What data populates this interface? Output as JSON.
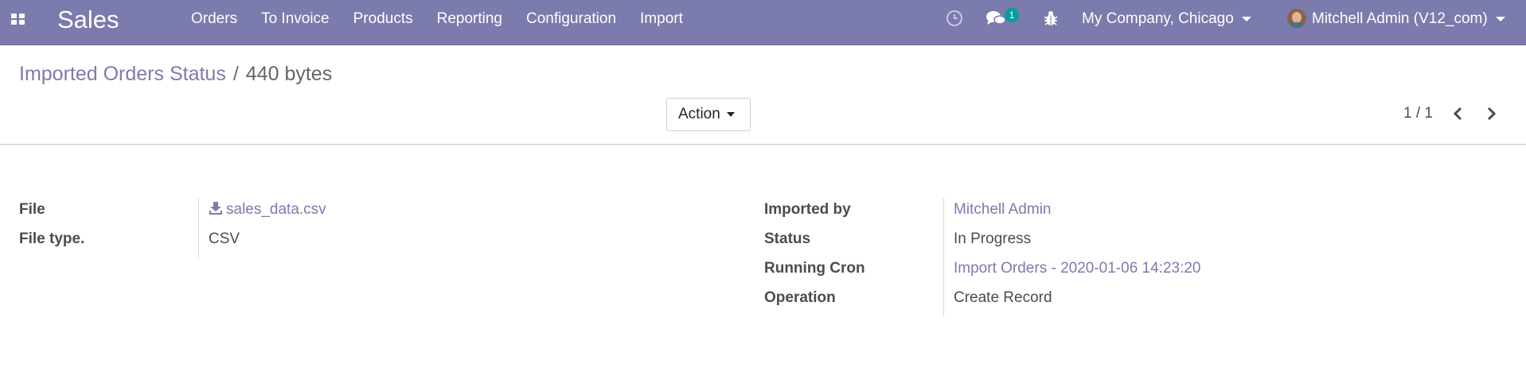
{
  "navbar": {
    "app_name": "Sales",
    "menu": [
      "Orders",
      "To Invoice",
      "Products",
      "Reporting",
      "Configuration",
      "Import"
    ],
    "messages_badge": "1",
    "company": "My Company, Chicago",
    "user": "Mitchell Admin (V12_com)",
    "icons": [
      "apps-grid-icon",
      "clock-icon",
      "chat-icon",
      "bug-icon"
    ],
    "bg_color": "#7c7bad",
    "badge_color": "#00a09d"
  },
  "breadcrumb": {
    "parent": "Imported Orders Status",
    "separator": "/",
    "current": "440 bytes"
  },
  "control_panel": {
    "action_label": "Action",
    "pager": "1 / 1"
  },
  "form": {
    "left": [
      {
        "label": "File",
        "value": "sales_data.csv",
        "icon": "download-icon"
      },
      {
        "label": "File type.",
        "value": "CSV"
      }
    ],
    "right": [
      {
        "label": "Imported by",
        "value": "Mitchell Admin"
      },
      {
        "label": "Status",
        "value": "In Progress"
      },
      {
        "label": "Running Cron",
        "value": "Import Orders - 2020-01-06 14:23:20"
      },
      {
        "label": "Operation",
        "value": "Create Record"
      }
    ],
    "link_color": "#7c7bad"
  }
}
